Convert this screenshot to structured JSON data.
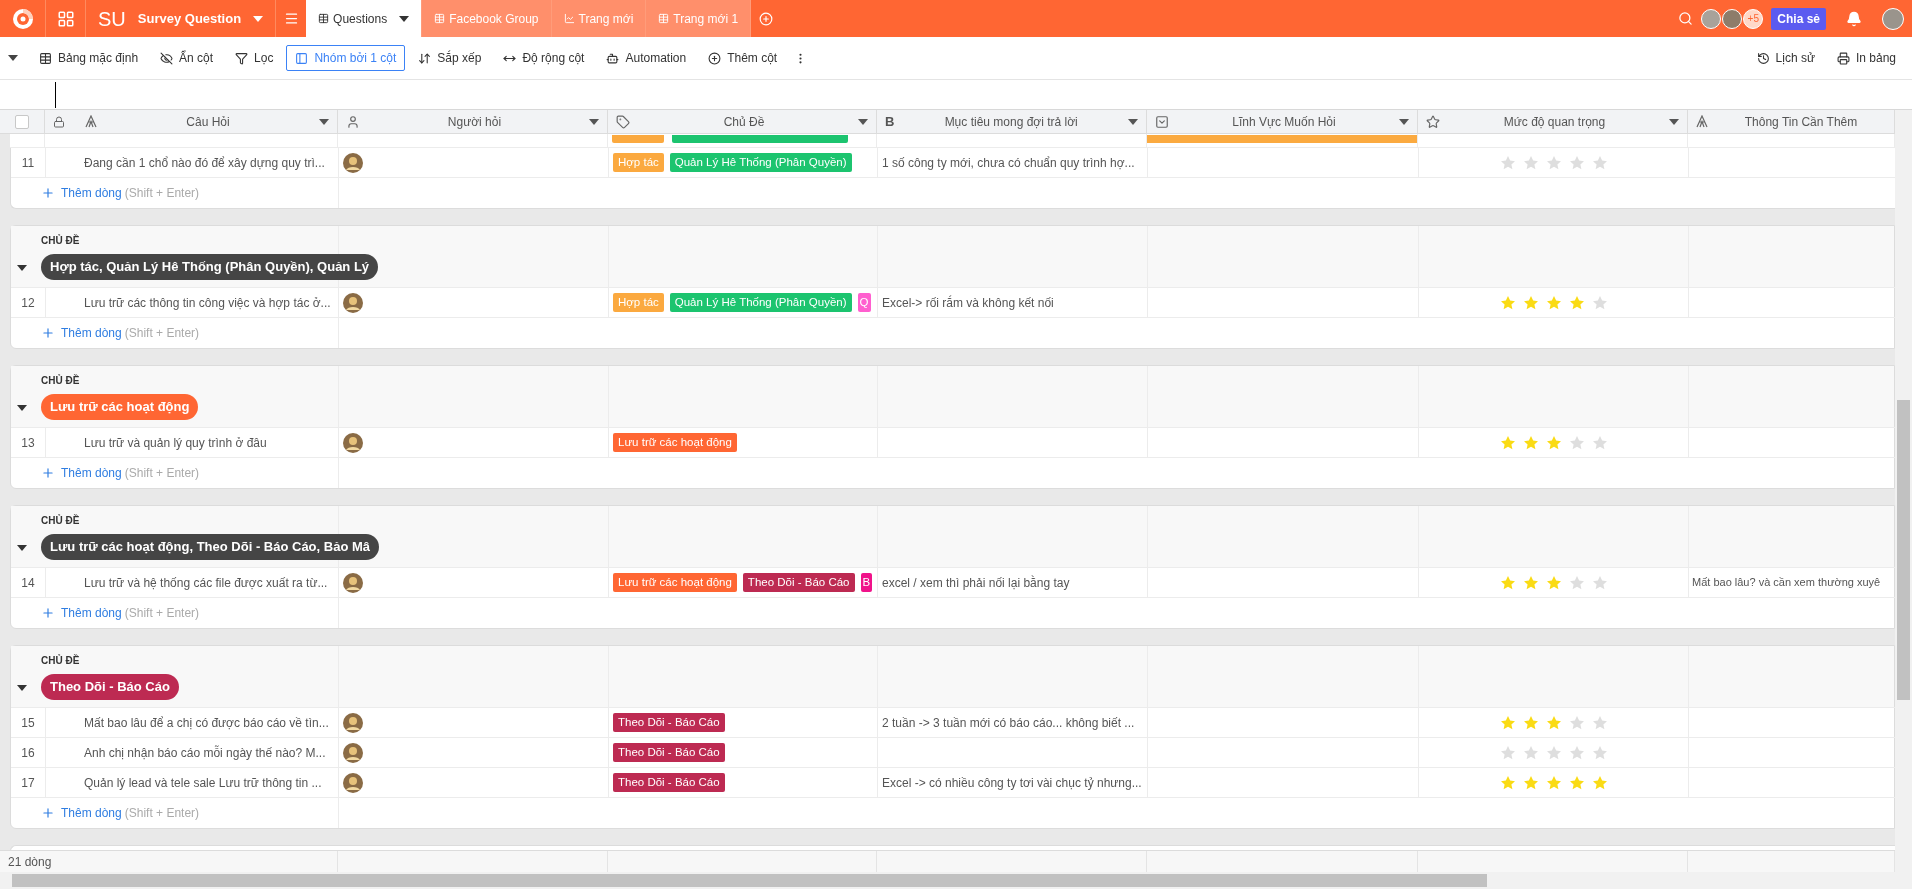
{
  "app": {
    "initials": "SU",
    "title": "Survey Question"
  },
  "tabs": [
    {
      "label": "Questions",
      "selected": true
    },
    {
      "label": "Facebook Group",
      "selected": false
    },
    {
      "label": "Trang mới",
      "selected": false
    },
    {
      "label": "Trang mới 1",
      "selected": false
    }
  ],
  "collaborators": {
    "extra": "+5"
  },
  "share_button": "Chia sẻ",
  "toolbar": [
    {
      "label": "Bảng mặc định",
      "selected": false
    },
    {
      "label": "Ẩn cột",
      "selected": false
    },
    {
      "label": "Lọc",
      "selected": false
    },
    {
      "label": "Nhóm bởi 1 cột",
      "selected": true
    },
    {
      "label": "Sắp xếp",
      "selected": false
    },
    {
      "label": "Độ rộng cột",
      "selected": false
    },
    {
      "label": "Automation",
      "selected": false
    },
    {
      "label": "Thêm cột",
      "selected": false
    }
  ],
  "toolbar_right": [
    {
      "label": "Lịch sử"
    },
    {
      "label": "In bảng"
    }
  ],
  "select_all": {
    "checked": false
  },
  "columns": [
    {
      "label": "Câu Hỏi",
      "dropdown": true
    },
    {
      "label": "Người hỏi",
      "dropdown": true
    },
    {
      "label": "Chủ Đề",
      "dropdown": true
    },
    {
      "label": "Mục tiêu mong đợi trả lời",
      "icon_text": "B",
      "dropdown": true
    },
    {
      "label": "Lĩnh Vực Muốn Hỏi",
      "dropdown": true
    },
    {
      "label": "Mức độ quan trọng",
      "dropdown": true
    },
    {
      "label": "Thông Tin Cần Thêm",
      "dropdown": false
    }
  ],
  "partial_row": {
    "tags": [
      {
        "color": "#fba93f"
      },
      {
        "color": "#1cc46f"
      }
    ]
  },
  "groups": [
    {
      "rows": [
        {
          "number": "11",
          "question": "Đang cần 1 chổ nào đó để xây dựng quy trì...",
          "has_asker": true,
          "tags": [
            {
              "label": "Hợp tác",
              "color": "#fba93f"
            },
            {
              "label": "Quản Lý Hê Thống (Phân Quyền)",
              "color": "#1cc46f"
            }
          ],
          "goal": "1 số công ty mới, chưa có chuẩn quy trình hợ...",
          "stars": 0
        }
      ],
      "add_row": {
        "label": "Thêm dòng",
        "hint": "(Shift + Enter)"
      }
    },
    {
      "heading": "CHỦ ĐỀ",
      "value": "Hợp tác, Quản Lý Hê Thống (Phân Quyền), Quản Lý",
      "color": "#454545",
      "rows": [
        {
          "number": "12",
          "question": "Lưu trữ các thông tin công việc và hợp tác ở...",
          "has_asker": true,
          "tags": [
            {
              "label": "Hợp tác",
              "color": "#fba93f"
            },
            {
              "label": "Quản Lý Hê Thống (Phân Quyền)",
              "color": "#1cc46f"
            },
            {
              "label": "Q",
              "color": "#ff5fcf"
            }
          ],
          "goal": "Excel-> rối rắm và không kết nối",
          "stars": 4
        }
      ],
      "add_row": {
        "label": "Thêm dòng",
        "hint": "(Shift + Enter)"
      }
    },
    {
      "heading": "CHỦ ĐỀ",
      "value": "Lưu trữ các hoạt động",
      "color": "#ff6633",
      "rows": [
        {
          "number": "13",
          "question": "Lưu trữ và quản lý quy trình ở đâu",
          "has_asker": true,
          "tags": [
            {
              "label": "Lưu trữ các hoạt động",
              "color": "#ff6633"
            }
          ],
          "stars": 3
        }
      ],
      "add_row": {
        "label": "Thêm dòng",
        "hint": "(Shift + Enter)"
      }
    },
    {
      "heading": "CHỦ ĐỀ",
      "value": "Lưu trữ các hoạt động, Theo Dõi - Báo Cáo, Bảo Mâ",
      "color": "#454545",
      "rows": [
        {
          "number": "14",
          "question": "Lưu trữ và hệ thống các file được xuất ra từ...",
          "has_asker": true,
          "tags": [
            {
              "label": "Lưu trữ các hoạt động",
              "color": "#ff6633"
            },
            {
              "label": "Theo Dõi - Báo Cáo",
              "color": "#bd2a52"
            },
            {
              "label": "B",
              "color": "#f0128a"
            }
          ],
          "goal": "excel / xem thì phải nối lại bằng tay",
          "stars": 3,
          "info": "Mất bao lâu? và cần xem thường xuyê"
        }
      ],
      "add_row": {
        "label": "Thêm dòng",
        "hint": "(Shift + Enter)"
      }
    },
    {
      "heading": "CHỦ ĐỀ",
      "value": "Theo Dõi - Báo Cáo",
      "color": "#bd2a52",
      "rows": [
        {
          "number": "15",
          "question": "Mất bao lâu để a chị có được báo cáo về tìn...",
          "has_asker": true,
          "tags": [
            {
              "label": "Theo Dõi - Báo Cáo",
              "color": "#bd2a52"
            }
          ],
          "goal": "2 tuần -> 3 tuần mới có báo cáo... không biết ...",
          "stars": 3
        },
        {
          "number": "16",
          "question": "Anh chị nhận báo cáo mỗi ngày thế nào? M...",
          "has_asker": true,
          "tags": [
            {
              "label": "Theo Dõi - Báo Cáo",
              "color": "#bd2a52"
            }
          ],
          "stars": 0
        },
        {
          "number": "17",
          "question": "Quản lý lead và tele sale Lưu trữ thông tin ...",
          "has_asker": true,
          "tags": [
            {
              "label": "Theo Dõi - Báo Cáo",
              "color": "#bd2a52"
            }
          ],
          "goal": "Excel -> có nhiều công ty tơi vài chục tỷ nhưng...",
          "stars": 5
        }
      ],
      "add_row": {
        "label": "Thêm dòng",
        "hint": "(Shift + Enter)"
      }
    }
  ],
  "footer": {
    "row_count": "21 dòng"
  }
}
